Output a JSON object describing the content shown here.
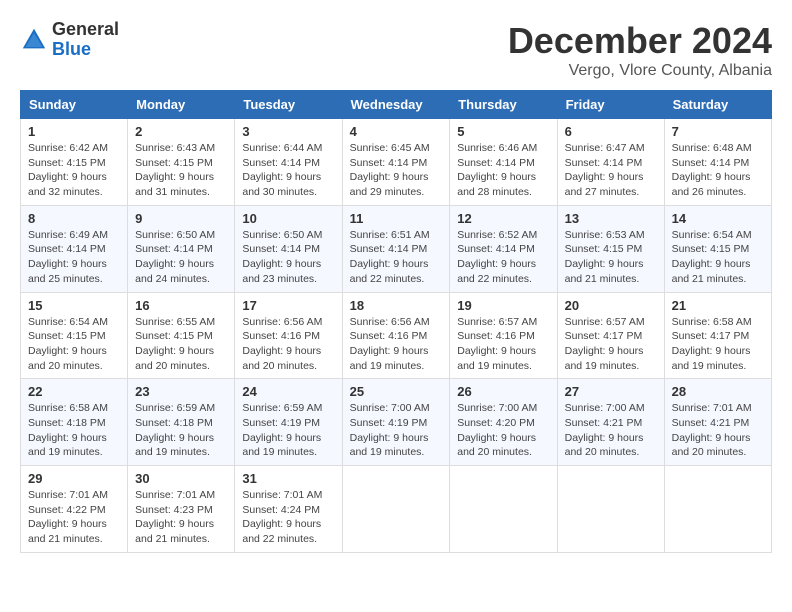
{
  "header": {
    "logo_general": "General",
    "logo_blue": "Blue",
    "month_title": "December 2024",
    "location": "Vergo, Vlore County, Albania"
  },
  "days_of_week": [
    "Sunday",
    "Monday",
    "Tuesday",
    "Wednesday",
    "Thursday",
    "Friday",
    "Saturday"
  ],
  "weeks": [
    [
      {
        "day": "1",
        "sunrise": "6:42 AM",
        "sunset": "4:15 PM",
        "daylight": "9 hours and 32 minutes."
      },
      {
        "day": "2",
        "sunrise": "6:43 AM",
        "sunset": "4:15 PM",
        "daylight": "9 hours and 31 minutes."
      },
      {
        "day": "3",
        "sunrise": "6:44 AM",
        "sunset": "4:14 PM",
        "daylight": "9 hours and 30 minutes."
      },
      {
        "day": "4",
        "sunrise": "6:45 AM",
        "sunset": "4:14 PM",
        "daylight": "9 hours and 29 minutes."
      },
      {
        "day": "5",
        "sunrise": "6:46 AM",
        "sunset": "4:14 PM",
        "daylight": "9 hours and 28 minutes."
      },
      {
        "day": "6",
        "sunrise": "6:47 AM",
        "sunset": "4:14 PM",
        "daylight": "9 hours and 27 minutes."
      },
      {
        "day": "7",
        "sunrise": "6:48 AM",
        "sunset": "4:14 PM",
        "daylight": "9 hours and 26 minutes."
      }
    ],
    [
      {
        "day": "8",
        "sunrise": "6:49 AM",
        "sunset": "4:14 PM",
        "daylight": "9 hours and 25 minutes."
      },
      {
        "day": "9",
        "sunrise": "6:50 AM",
        "sunset": "4:14 PM",
        "daylight": "9 hours and 24 minutes."
      },
      {
        "day": "10",
        "sunrise": "6:50 AM",
        "sunset": "4:14 PM",
        "daylight": "9 hours and 23 minutes."
      },
      {
        "day": "11",
        "sunrise": "6:51 AM",
        "sunset": "4:14 PM",
        "daylight": "9 hours and 22 minutes."
      },
      {
        "day": "12",
        "sunrise": "6:52 AM",
        "sunset": "4:14 PM",
        "daylight": "9 hours and 22 minutes."
      },
      {
        "day": "13",
        "sunrise": "6:53 AM",
        "sunset": "4:15 PM",
        "daylight": "9 hours and 21 minutes."
      },
      {
        "day": "14",
        "sunrise": "6:54 AM",
        "sunset": "4:15 PM",
        "daylight": "9 hours and 21 minutes."
      }
    ],
    [
      {
        "day": "15",
        "sunrise": "6:54 AM",
        "sunset": "4:15 PM",
        "daylight": "9 hours and 20 minutes."
      },
      {
        "day": "16",
        "sunrise": "6:55 AM",
        "sunset": "4:15 PM",
        "daylight": "9 hours and 20 minutes."
      },
      {
        "day": "17",
        "sunrise": "6:56 AM",
        "sunset": "4:16 PM",
        "daylight": "9 hours and 20 minutes."
      },
      {
        "day": "18",
        "sunrise": "6:56 AM",
        "sunset": "4:16 PM",
        "daylight": "9 hours and 19 minutes."
      },
      {
        "day": "19",
        "sunrise": "6:57 AM",
        "sunset": "4:16 PM",
        "daylight": "9 hours and 19 minutes."
      },
      {
        "day": "20",
        "sunrise": "6:57 AM",
        "sunset": "4:17 PM",
        "daylight": "9 hours and 19 minutes."
      },
      {
        "day": "21",
        "sunrise": "6:58 AM",
        "sunset": "4:17 PM",
        "daylight": "9 hours and 19 minutes."
      }
    ],
    [
      {
        "day": "22",
        "sunrise": "6:58 AM",
        "sunset": "4:18 PM",
        "daylight": "9 hours and 19 minutes."
      },
      {
        "day": "23",
        "sunrise": "6:59 AM",
        "sunset": "4:18 PM",
        "daylight": "9 hours and 19 minutes."
      },
      {
        "day": "24",
        "sunrise": "6:59 AM",
        "sunset": "4:19 PM",
        "daylight": "9 hours and 19 minutes."
      },
      {
        "day": "25",
        "sunrise": "7:00 AM",
        "sunset": "4:19 PM",
        "daylight": "9 hours and 19 minutes."
      },
      {
        "day": "26",
        "sunrise": "7:00 AM",
        "sunset": "4:20 PM",
        "daylight": "9 hours and 20 minutes."
      },
      {
        "day": "27",
        "sunrise": "7:00 AM",
        "sunset": "4:21 PM",
        "daylight": "9 hours and 20 minutes."
      },
      {
        "day": "28",
        "sunrise": "7:01 AM",
        "sunset": "4:21 PM",
        "daylight": "9 hours and 20 minutes."
      }
    ],
    [
      {
        "day": "29",
        "sunrise": "7:01 AM",
        "sunset": "4:22 PM",
        "daylight": "9 hours and 21 minutes."
      },
      {
        "day": "30",
        "sunrise": "7:01 AM",
        "sunset": "4:23 PM",
        "daylight": "9 hours and 21 minutes."
      },
      {
        "day": "31",
        "sunrise": "7:01 AM",
        "sunset": "4:24 PM",
        "daylight": "9 hours and 22 minutes."
      },
      null,
      null,
      null,
      null
    ]
  ]
}
